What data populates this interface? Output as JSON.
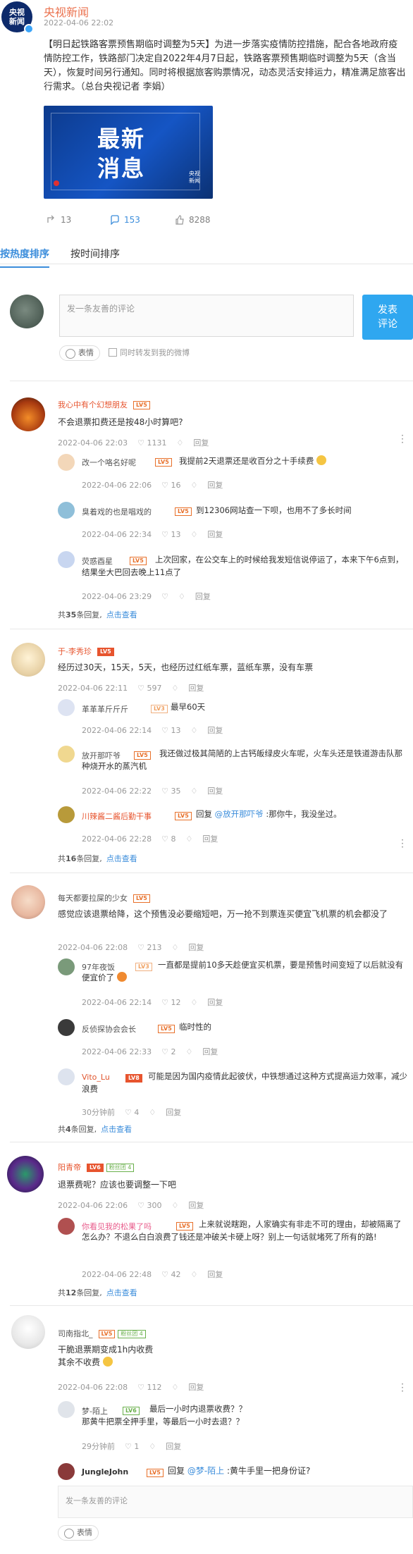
{
  "post": {
    "user": "央视新闻",
    "avatar_text": "央视新闻",
    "time": "2022-04-06 22:02",
    "text": "【明日起铁路客票预售期临时调整为5天】为进一步落实疫情防控措施，配合各地政府疫情防控工作，铁路部门决定自2022年4月7日起，铁路客票预售期临时调整为5天（含当天），恢复时间另行通知。同时将根据旅客购票情况，动态灵活安排运力，精准满足旅客出行需求。（总台央视记者 李娟）",
    "image_text": "最新消息",
    "image_badge": "央视新闻",
    "reposts": "13",
    "comments": "153",
    "likes": "8288"
  },
  "tabs": {
    "hot": "按热度排序",
    "time": "按时间排序"
  },
  "compose": {
    "placeholder": "发一条友善的评论",
    "send": "发表评论",
    "emoji": "表情",
    "sync": "同时转发到我的微博"
  },
  "comments": [
    {
      "user": "我心中有个幻想朋友",
      "level": "LV5",
      "text": "不会退票扣费还是按48小时算吧?",
      "time": "2022-04-06 22:03",
      "likes": "1131",
      "reply": "回复",
      "replies": [
        {
          "user": "改一个咯名好呢",
          "level": "LV5",
          "text": "我提前2天退票还是收百分之十手续费",
          "time": "2022-04-06 22:06",
          "likes": "16",
          "reply": "回复"
        },
        {
          "user": "臭着戏的也是唱戏的",
          "level": "LV5",
          "text": "到12306网站查一下呗，也用不了多长时间",
          "time": "2022-04-06 22:34",
          "likes": "13",
          "reply": "回复"
        },
        {
          "user": "荧惑酉星",
          "level": "LV5",
          "text": "上次回家，在公交车上的时候给我发短信说停运了，本来下午6点到，结果坐大巴回去晚上11点了",
          "time": "2022-04-06 23:29",
          "likes": "",
          "reply": "回复"
        }
      ],
      "total_prefix": "共",
      "total_num": "35",
      "total_suffix": "条回复,",
      "view": "点击查看"
    },
    {
      "user": "于-李秀珍",
      "level": "LV5",
      "text": "经历过30天，15天，5天，也经历过红纸车票，蓝纸车票，没有车票",
      "time": "2022-04-06 22:11",
      "likes": "597",
      "reply": "回复",
      "replies": [
        {
          "user": "革革革斤斤斤",
          "level": "LV3",
          "text": "最早60天",
          "time": "2022-04-06 22:14",
          "likes": "13",
          "reply": "回复"
        },
        {
          "user": "放开那吓爷",
          "level": "LV5",
          "text": "我还做过极其简陋的上古钙皈绿皮火车呢，火车头还是铁道游击队那种烧开水的蒸汽机",
          "time": "2022-04-06 22:22",
          "likes": "35",
          "reply": "回复"
        },
        {
          "user": "川辣酱二酱后勤干事",
          "level": "LV5",
          "reply_prefix": "回复",
          "at": "@放开那吓爷",
          "text": ":那你牛，我没坐过。",
          "time": "2022-04-06 22:28",
          "likes": "8",
          "reply": "回复"
        }
      ],
      "total_prefix": "共",
      "total_num": "16",
      "total_suffix": "条回复,",
      "view": "点击查看"
    },
    {
      "user": "每天都要拉屎的少女",
      "level": "LV5",
      "text": "感觉应该退票给降，这个预售没必要缩短吧，万一抢不到票连买便宜飞机票的机会都没了",
      "time": "2022-04-06 22:08",
      "likes": "213",
      "reply": "回复",
      "replies": [
        {
          "user": "97年夜饭",
          "level": "LV3",
          "text": "一直都是提前10多天趁便宜买机票，要是预售时间变短了以后就没有便宜价了",
          "time": "2022-04-06 22:14",
          "likes": "12",
          "reply": "回复"
        },
        {
          "user": "反侦探协会会长",
          "level": "LV5",
          "text": "临时性的",
          "time": "2022-04-06 22:33",
          "likes": "2",
          "reply": "回复"
        },
        {
          "user": "Vito_Lu",
          "level": "LV8",
          "text": "可能是因为国内疫情此起彼伏，中铁想通过这种方式提高运力效率，减少浪费",
          "time": "30分钟前",
          "likes": "4",
          "reply": "回复"
        }
      ],
      "total_prefix": "共",
      "total_num": "4",
      "total_suffix": "条回复,",
      "view": "点击查看"
    },
    {
      "user": "阳青帝",
      "level": "LV6",
      "fan": "粉丝团 4",
      "text": "退票费呢？应该也要调整一下吧",
      "time": "2022-04-06 22:06",
      "likes": "300",
      "reply": "回复",
      "replies": [
        {
          "user": "你看见我的松果了吗",
          "level": "LV5",
          "text": "上来就说瞎跑，人家确实有非走不可的理由，却被隔离了怎么办？不退么白白浪费了钱还是冲破关卡硬上呀？别上一句话就堵死了所有的路!",
          "time": "2022-04-06 22:48",
          "likes": "42",
          "reply": "回复"
        }
      ],
      "total_prefix": "共",
      "total_num": "12",
      "total_suffix": "条回复,",
      "view": "点击查看"
    },
    {
      "user": "司南指北_",
      "level": "LV5",
      "fan": "粉丝团 4",
      "text": "干脆退票期变成1h内收费\n其余不收费",
      "time": "2022-04-06 22:08",
      "likes": "112",
      "reply": "回复",
      "replies": [
        {
          "user": "梦-陌上",
          "level": "LV6",
          "text": "最后一小时内退票收费？？\n那黄牛把票全押手里，等最后一小时去退？？",
          "time": "29分钟前",
          "likes": "1",
          "reply": "回复"
        },
        {
          "user": "JungleJohn",
          "level": "LV5",
          "reply_prefix": "回复",
          "at": "@梦-陌上",
          "text": ":黄牛手里一把身份证?",
          "time": "",
          "likes": "",
          "reply": ""
        }
      ]
    }
  ],
  "bottom": {
    "placeholder": "发一条友善的评论",
    "emoji": "表情"
  }
}
